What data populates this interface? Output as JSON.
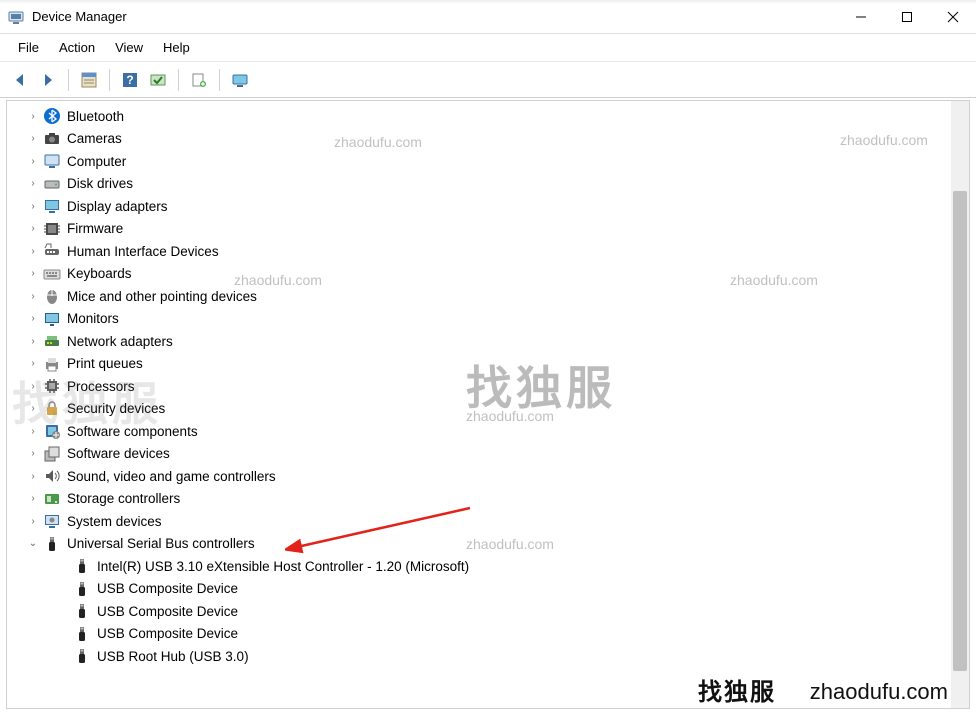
{
  "window": {
    "title": "Device Manager"
  },
  "menu": {
    "file": "File",
    "action": "Action",
    "view": "View",
    "help": "Help"
  },
  "tree": {
    "items": [
      {
        "label": "Bluetooth",
        "icon": "bluetooth",
        "exp": ">"
      },
      {
        "label": "Cameras",
        "icon": "camera",
        "exp": ">"
      },
      {
        "label": "Computer",
        "icon": "computer",
        "exp": ">"
      },
      {
        "label": "Disk drives",
        "icon": "disk",
        "exp": ">"
      },
      {
        "label": "Display adapters",
        "icon": "display",
        "exp": ">"
      },
      {
        "label": "Firmware",
        "icon": "firmware",
        "exp": ">"
      },
      {
        "label": "Human Interface Devices",
        "icon": "hid",
        "exp": ">"
      },
      {
        "label": "Keyboards",
        "icon": "keyboard",
        "exp": ">"
      },
      {
        "label": "Mice and other pointing devices",
        "icon": "mouse",
        "exp": ">"
      },
      {
        "label": "Monitors",
        "icon": "monitor",
        "exp": ">"
      },
      {
        "label": "Network adapters",
        "icon": "network",
        "exp": ">"
      },
      {
        "label": "Print queues",
        "icon": "printer",
        "exp": ">"
      },
      {
        "label": "Processors",
        "icon": "cpu",
        "exp": ">"
      },
      {
        "label": "Security devices",
        "icon": "security",
        "exp": ">"
      },
      {
        "label": "Software components",
        "icon": "software",
        "exp": ">"
      },
      {
        "label": "Software devices",
        "icon": "software2",
        "exp": ">"
      },
      {
        "label": "Sound, video and game controllers",
        "icon": "sound",
        "exp": ">"
      },
      {
        "label": "Storage controllers",
        "icon": "storage",
        "exp": ">"
      },
      {
        "label": "System devices",
        "icon": "system",
        "exp": ">"
      },
      {
        "label": "Universal Serial Bus controllers",
        "icon": "usb",
        "exp": "v",
        "children": [
          {
            "label": "Intel(R) USB 3.10 eXtensible Host Controller - 1.20 (Microsoft)",
            "icon": "usb"
          },
          {
            "label": "USB Composite Device",
            "icon": "usb"
          },
          {
            "label": "USB Composite Device",
            "icon": "usb"
          },
          {
            "label": "USB Composite Device",
            "icon": "usb"
          },
          {
            "label": "USB Root Hub (USB 3.0)",
            "icon": "usb"
          }
        ]
      }
    ]
  },
  "watermarks": {
    "w1": "zhaodufu.com",
    "w2": "zhaodufu.com",
    "w3": "zhaodufu.com",
    "w4": "zhaodufu.com",
    "w5": "zhaodufu.com",
    "w6": "zhaodufu.com",
    "big1": "找独服",
    "big2": "找独服",
    "footer_cn": "找独服",
    "footer_url": "zhaodufu.com"
  }
}
